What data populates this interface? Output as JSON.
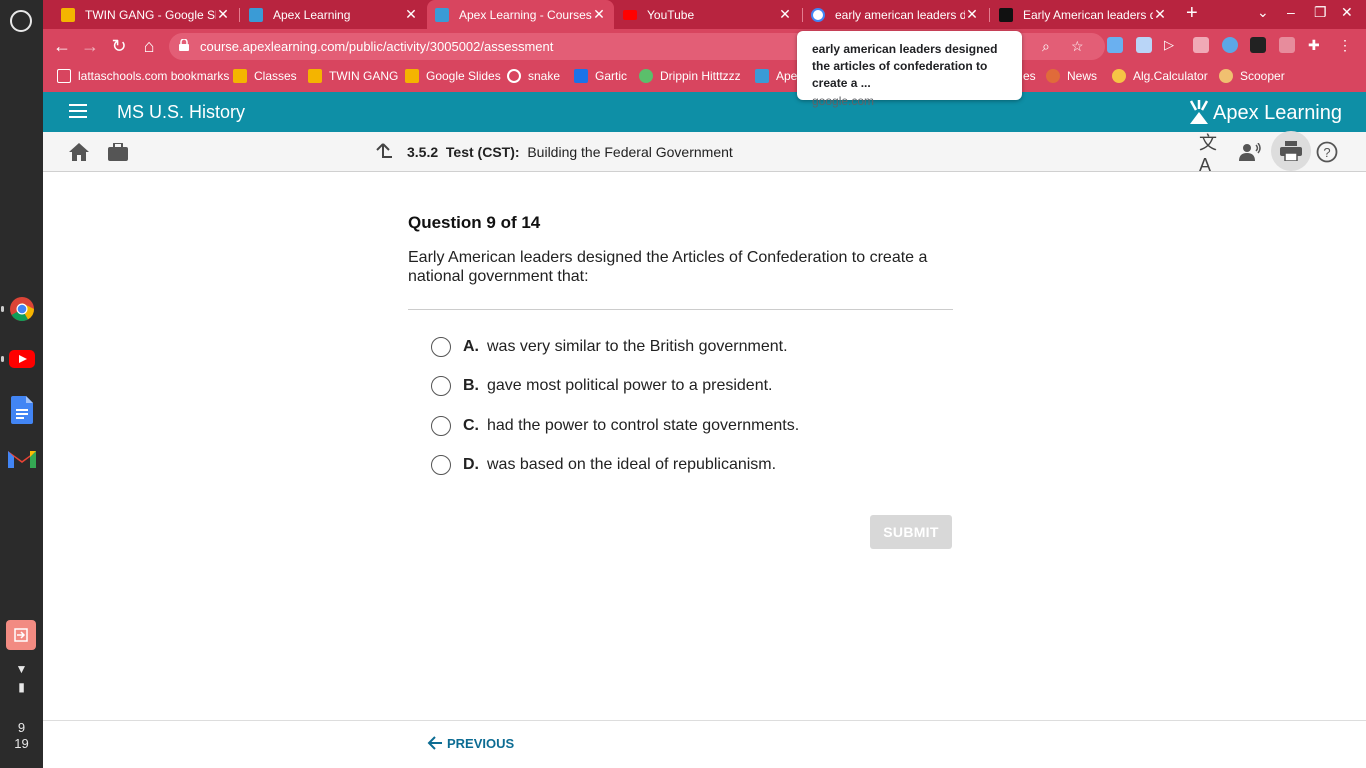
{
  "shelf": {
    "clock_hour": "9",
    "clock_minute": "19",
    "apps": [
      "launcher-icon",
      "chrome-icon",
      "youtube-icon",
      "docs-icon",
      "gmail-icon"
    ]
  },
  "tabs": [
    {
      "title": "TWIN GANG - Google Slides",
      "favicon_color": "#f4b400"
    },
    {
      "title": "Apex Learning",
      "favicon_color": "#3a9bd6"
    },
    {
      "title": "Apex Learning - Courses",
      "favicon_color": "#3a9bd6",
      "active": true
    },
    {
      "title": "YouTube",
      "favicon_color": "#ff0000"
    },
    {
      "title": "early american leaders designed",
      "favicon_color": "#ffffff"
    },
    {
      "title": "Early American leaders designed",
      "favicon_color": "#111111"
    }
  ],
  "toolbar": {
    "url": "course.apexlearning.com/public/activity/3005002/assessment"
  },
  "bookmarks": [
    {
      "label": "lattaschools.com bookmarks",
      "icon": "folder-icon"
    },
    {
      "label": "Classes",
      "icon": "classes-icon"
    },
    {
      "label": "TWIN GANG",
      "icon": "slides-icon"
    },
    {
      "label": "Google Slides",
      "icon": "slides-icon"
    },
    {
      "label": "snake",
      "icon": "google-icon"
    },
    {
      "label": "Gartic",
      "icon": "gartic-icon"
    },
    {
      "label": "Drippin Hitttzzz",
      "icon": "drip-icon"
    },
    {
      "label": "Ape",
      "icon": "apex-icon"
    },
    {
      "label": "es",
      "icon": "folder-icon"
    },
    {
      "label": "News",
      "icon": "news-icon"
    },
    {
      "label": "Alg.Calculator",
      "icon": "calc-icon"
    },
    {
      "label": "Scooper",
      "icon": "scooper-icon"
    }
  ],
  "tooltip": {
    "title": "early american leaders designed the articles of confederation to create a ...",
    "host": "google.com"
  },
  "apex": {
    "course_title": "MS U.S. History",
    "logo_text": "Apex Learning",
    "breadcrumb_code": "3.5.2",
    "breadcrumb_type": "Test (CST):",
    "breadcrumb_title": "Building the Federal Government"
  },
  "question": {
    "number_label": "Question 9 of 14",
    "text": "Early American leaders designed the Articles of Confederation to create a national government that:",
    "choices": [
      {
        "letter": "A.",
        "text": "was very similar to the British government."
      },
      {
        "letter": "B.",
        "text": "gave most political power to a president."
      },
      {
        "letter": "C.",
        "text": "had the power to control state governments."
      },
      {
        "letter": "D.",
        "text": "was based on the ideal of republicanism."
      }
    ],
    "submit_label": "SUBMIT"
  },
  "footer": {
    "previous_label": "PREVIOUS"
  },
  "colors": {
    "browser_theme": "#d8455f",
    "tabstrip": "#b8243f",
    "apex_teal": "#0e8fa6",
    "link_blue": "#0c6c93"
  }
}
